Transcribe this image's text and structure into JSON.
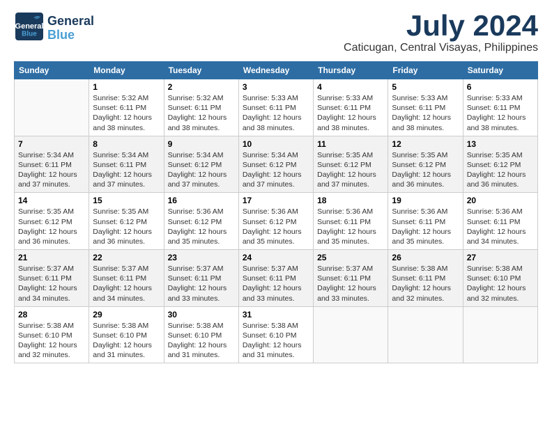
{
  "header": {
    "logo_line1": "General",
    "logo_line2": "Blue",
    "title": "July 2024",
    "subtitle": "Caticugan, Central Visayas, Philippines"
  },
  "days_of_week": [
    "Sunday",
    "Monday",
    "Tuesday",
    "Wednesday",
    "Thursday",
    "Friday",
    "Saturday"
  ],
  "weeks": [
    [
      {
        "day": "",
        "info": ""
      },
      {
        "day": "1",
        "info": "Sunrise: 5:32 AM\nSunset: 6:11 PM\nDaylight: 12 hours\nand 38 minutes."
      },
      {
        "day": "2",
        "info": "Sunrise: 5:32 AM\nSunset: 6:11 PM\nDaylight: 12 hours\nand 38 minutes."
      },
      {
        "day": "3",
        "info": "Sunrise: 5:33 AM\nSunset: 6:11 PM\nDaylight: 12 hours\nand 38 minutes."
      },
      {
        "day": "4",
        "info": "Sunrise: 5:33 AM\nSunset: 6:11 PM\nDaylight: 12 hours\nand 38 minutes."
      },
      {
        "day": "5",
        "info": "Sunrise: 5:33 AM\nSunset: 6:11 PM\nDaylight: 12 hours\nand 38 minutes."
      },
      {
        "day": "6",
        "info": "Sunrise: 5:33 AM\nSunset: 6:11 PM\nDaylight: 12 hours\nand 38 minutes."
      }
    ],
    [
      {
        "day": "7",
        "info": "Sunrise: 5:34 AM\nSunset: 6:11 PM\nDaylight: 12 hours\nand 37 minutes."
      },
      {
        "day": "8",
        "info": "Sunrise: 5:34 AM\nSunset: 6:11 PM\nDaylight: 12 hours\nand 37 minutes."
      },
      {
        "day": "9",
        "info": "Sunrise: 5:34 AM\nSunset: 6:12 PM\nDaylight: 12 hours\nand 37 minutes."
      },
      {
        "day": "10",
        "info": "Sunrise: 5:34 AM\nSunset: 6:12 PM\nDaylight: 12 hours\nand 37 minutes."
      },
      {
        "day": "11",
        "info": "Sunrise: 5:35 AM\nSunset: 6:12 PM\nDaylight: 12 hours\nand 37 minutes."
      },
      {
        "day": "12",
        "info": "Sunrise: 5:35 AM\nSunset: 6:12 PM\nDaylight: 12 hours\nand 36 minutes."
      },
      {
        "day": "13",
        "info": "Sunrise: 5:35 AM\nSunset: 6:12 PM\nDaylight: 12 hours\nand 36 minutes."
      }
    ],
    [
      {
        "day": "14",
        "info": "Sunrise: 5:35 AM\nSunset: 6:12 PM\nDaylight: 12 hours\nand 36 minutes."
      },
      {
        "day": "15",
        "info": "Sunrise: 5:35 AM\nSunset: 6:12 PM\nDaylight: 12 hours\nand 36 minutes."
      },
      {
        "day": "16",
        "info": "Sunrise: 5:36 AM\nSunset: 6:12 PM\nDaylight: 12 hours\nand 35 minutes."
      },
      {
        "day": "17",
        "info": "Sunrise: 5:36 AM\nSunset: 6:12 PM\nDaylight: 12 hours\nand 35 minutes."
      },
      {
        "day": "18",
        "info": "Sunrise: 5:36 AM\nSunset: 6:11 PM\nDaylight: 12 hours\nand 35 minutes."
      },
      {
        "day": "19",
        "info": "Sunrise: 5:36 AM\nSunset: 6:11 PM\nDaylight: 12 hours\nand 35 minutes."
      },
      {
        "day": "20",
        "info": "Sunrise: 5:36 AM\nSunset: 6:11 PM\nDaylight: 12 hours\nand 34 minutes."
      }
    ],
    [
      {
        "day": "21",
        "info": "Sunrise: 5:37 AM\nSunset: 6:11 PM\nDaylight: 12 hours\nand 34 minutes."
      },
      {
        "day": "22",
        "info": "Sunrise: 5:37 AM\nSunset: 6:11 PM\nDaylight: 12 hours\nand 34 minutes."
      },
      {
        "day": "23",
        "info": "Sunrise: 5:37 AM\nSunset: 6:11 PM\nDaylight: 12 hours\nand 33 minutes."
      },
      {
        "day": "24",
        "info": "Sunrise: 5:37 AM\nSunset: 6:11 PM\nDaylight: 12 hours\nand 33 minutes."
      },
      {
        "day": "25",
        "info": "Sunrise: 5:37 AM\nSunset: 6:11 PM\nDaylight: 12 hours\nand 33 minutes."
      },
      {
        "day": "26",
        "info": "Sunrise: 5:38 AM\nSunset: 6:11 PM\nDaylight: 12 hours\nand 32 minutes."
      },
      {
        "day": "27",
        "info": "Sunrise: 5:38 AM\nSunset: 6:10 PM\nDaylight: 12 hours\nand 32 minutes."
      }
    ],
    [
      {
        "day": "28",
        "info": "Sunrise: 5:38 AM\nSunset: 6:10 PM\nDaylight: 12 hours\nand 32 minutes."
      },
      {
        "day": "29",
        "info": "Sunrise: 5:38 AM\nSunset: 6:10 PM\nDaylight: 12 hours\nand 31 minutes."
      },
      {
        "day": "30",
        "info": "Sunrise: 5:38 AM\nSunset: 6:10 PM\nDaylight: 12 hours\nand 31 minutes."
      },
      {
        "day": "31",
        "info": "Sunrise: 5:38 AM\nSunset: 6:10 PM\nDaylight: 12 hours\nand 31 minutes."
      },
      {
        "day": "",
        "info": ""
      },
      {
        "day": "",
        "info": ""
      },
      {
        "day": "",
        "info": ""
      }
    ]
  ]
}
